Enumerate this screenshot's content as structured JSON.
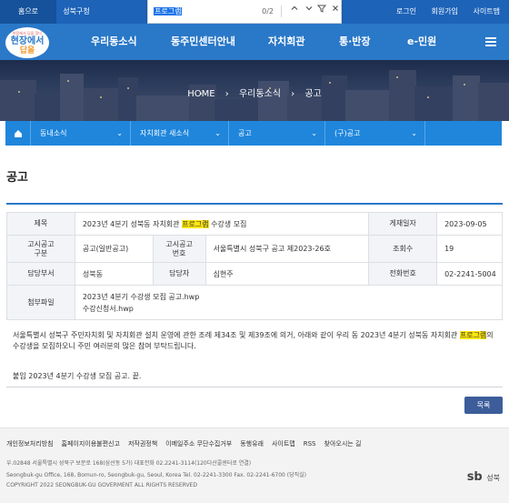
{
  "topbar": {
    "home_tab": "홈으로",
    "gu_tab": "성북구청",
    "login": "로그인",
    "join": "회원가입",
    "sitemap": "사이트맵"
  },
  "find": {
    "query": "프로그램",
    "count": "0/2",
    "up_icon": "chevron-up-icon",
    "down_icon": "chevron-down-icon",
    "filter_icon": "filter-icon",
    "close_icon": "close-icon"
  },
  "logo": {
    "sub": "현장에서 답을 찾다",
    "main": "현장에서",
    "main2": "답을"
  },
  "nav": {
    "items": [
      "우리동소식",
      "동주민센터안내",
      "자치회관",
      "통·반장",
      "e-민원"
    ]
  },
  "hero": {
    "crumbs": [
      "HOME",
      "우리동소식",
      "공고"
    ]
  },
  "subnav": {
    "items": [
      "동내소식",
      "자치회관 새소식",
      "공고",
      "(구)공고"
    ]
  },
  "page_title": "공고",
  "info": {
    "subject_label": "제목",
    "subject_pre": "2023년 4분기 성북동 자치회관 ",
    "subject_hl": "프로그램",
    "subject_post": " 수강생 모집",
    "date_label": "게재일자",
    "date": "2023-09-05",
    "type_label1": "고시공고",
    "type_label2": "구분",
    "type": "공고(일반공고)",
    "no_label1": "고시공고",
    "no_label2": "번호",
    "no": "서울특별시 성북구 공고 제2023-26호",
    "views_label": "조회수",
    "views": "19",
    "dept_label": "담당부서",
    "dept": "성북동",
    "person_label": "담당자",
    "person": "심현주",
    "phone_label": "전화번호",
    "phone": "02-2241-5004",
    "files_label": "첨부파일",
    "files": [
      "2023년 4분기 수강생 모집 공고.hwp",
      "수강신청서.hwp"
    ]
  },
  "body": {
    "para_pre": "서울특별시 성북구 주민자치회 및 자치회관 설치 운영에 관한 조례 제34조 및 제39조에 의거, 아래와 같이 우리 동 2023년 4분기 성북동 자치회관 ",
    "para_hl": "프로그램",
    "para_post": "의 수강생을 모집하오니 주민 여러분의 많은 참여 부탁드립니다.",
    "attach_line": "붙임 2023년 4분기 수강생 모집 공고. 끝."
  },
  "list_button": "목록",
  "footer": {
    "links": [
      "개인정보처리방침",
      "홈페이지이용불편신고",
      "저작권정책",
      "이메일주소 무단수집거부",
      "동행유래",
      "사이트맵",
      "RSS",
      "찾아오시는 길"
    ],
    "address": "우.02848 서울특별시 성북구 보문로 168(삼선동 5가) 대표전화 02.2241-3114(120다산콜센터로 연결)",
    "address_en": "Seongbuk-gu Office, 168, Bomun-ro, Seongbuk-gu, Seoul, Korea Tel. 02-2241-3300 Fax. 02-2241-6700 (당직실)",
    "copyright": "COPYRIGHT 2022 SEONGBUK-GU GOVERMENT ALL RIGHTS RESERVED",
    "brand_mark": "sb",
    "brand_text": "성북"
  }
}
